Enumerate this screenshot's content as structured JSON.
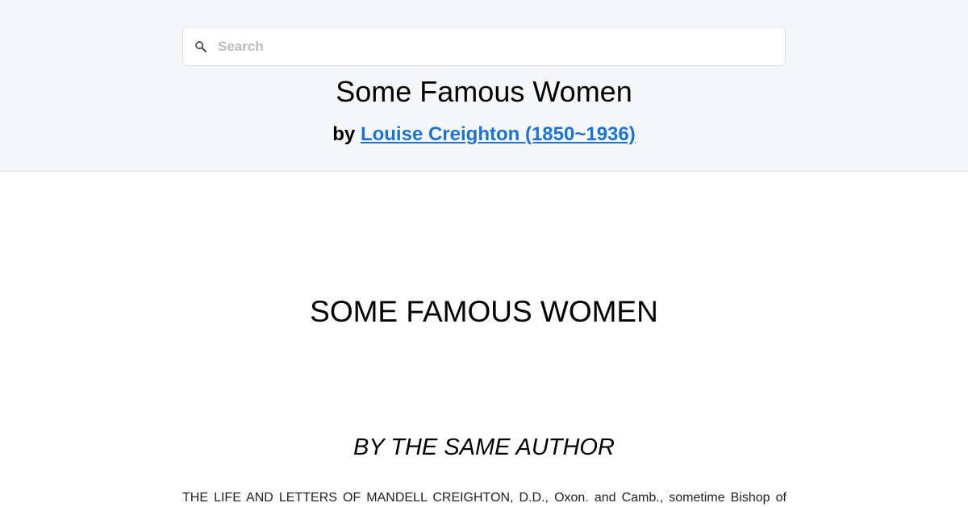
{
  "search": {
    "placeholder": "Search",
    "value": ""
  },
  "header": {
    "title": "Some Famous Women",
    "by_prefix": "by",
    "author_link": "Louise Creighton (1850~1936)"
  },
  "content": {
    "main_heading": "SOME FAMOUS WOMEN",
    "section_heading": "BY THE SAME AUTHOR",
    "paragraph": "THE LIFE AND LETTERS OF MANDELL CREIGHTON, D.D., Oxon. and Camb., sometime Bishop of"
  },
  "colors": {
    "header_background": "#f6f7f9",
    "link": "#1a73d9",
    "page_background": "#ffffff"
  },
  "icons": {
    "search": "magnifying-glass"
  }
}
